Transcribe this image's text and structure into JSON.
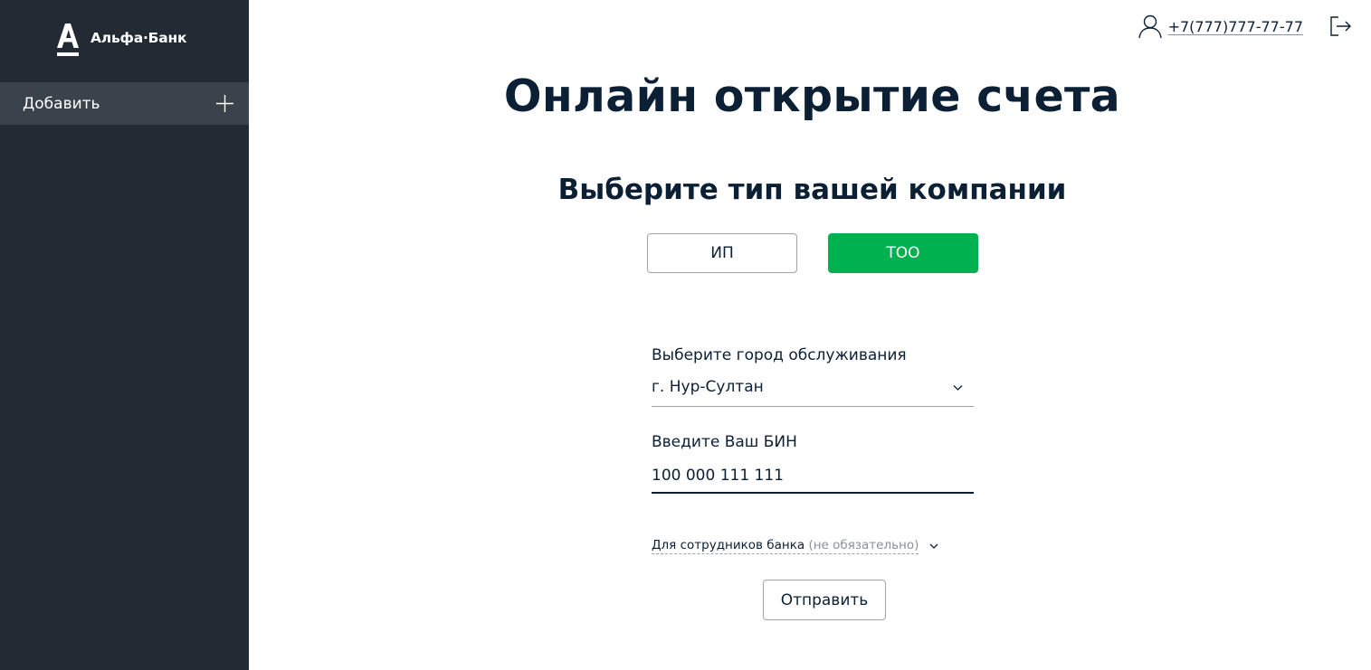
{
  "sidebar": {
    "logo_text": "Альфа·Банк",
    "add_label": "Добавить"
  },
  "header": {
    "phone": "+7(777)777-77-77"
  },
  "main": {
    "title": "Онлайн открытие счета",
    "subtitle": "Выберите тип вашей компании",
    "company_types": [
      {
        "label": "ИП",
        "selected": false
      },
      {
        "label": "ТОО",
        "selected": true
      }
    ],
    "city_label": "Выберите город обслуживания",
    "city_value": "г. Нур-Султан",
    "bin_label": "Введите Ваш БИН",
    "bin_value": "100 000 111 111",
    "staff_label": "Для сотрудников банка",
    "staff_optional": "(не обязательно)",
    "submit_label": "Отправить"
  },
  "colors": {
    "sidebar_bg": "#222b33",
    "sidebar_active_bg": "#3a434b",
    "accent_green": "#00b14f",
    "text_dark": "#0b1f35"
  },
  "icons": [
    "alfa-logo-icon",
    "plus-icon",
    "user-icon",
    "logout-icon",
    "chevron-down-icon"
  ]
}
